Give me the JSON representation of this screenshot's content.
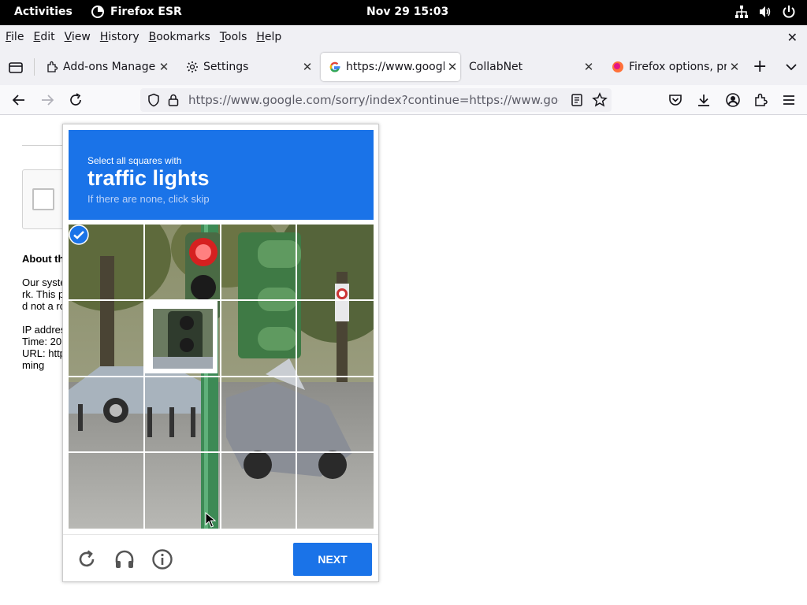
{
  "topbar": {
    "activities": "Activities",
    "app_name": "Firefox ESR",
    "clock": "Nov 29  15:03"
  },
  "menubar": {
    "items": [
      {
        "label": "File",
        "u": "F",
        "rest": "ile"
      },
      {
        "label": "Edit",
        "u": "E",
        "rest": "dit"
      },
      {
        "label": "View",
        "u": "V",
        "rest": "iew"
      },
      {
        "label": "History",
        "u": "H",
        "rest": "istory"
      },
      {
        "label": "Bookmarks",
        "u": "B",
        "rest": "ookmarks"
      },
      {
        "label": "Tools",
        "u": "T",
        "rest": "ools"
      },
      {
        "label": "Help",
        "u": "H",
        "rest": "elp"
      }
    ]
  },
  "tabs": [
    {
      "label": "Add-ons Manager",
      "icon": "puzzle-icon"
    },
    {
      "label": "Settings",
      "icon": "gear-icon"
    },
    {
      "label": "https://www.google.com/sorry",
      "icon": "google-g-icon",
      "active": true
    },
    {
      "label": "CollabNet",
      "icon": ""
    },
    {
      "label": "Firefox options, preferences",
      "icon": "firefox-support-icon"
    }
  ],
  "urlbar": {
    "url": "https://www.google.com/sorry/index?continue=https://www.google.com/search"
  },
  "page": {
    "about_heading": "About th",
    "para_lines": [
      "Our syste",
      "rk. This p",
      "d not a ro"
    ],
    "info_lines": [
      "IP addres",
      "Time: 20",
      "URL: http",
      "ming"
    ]
  },
  "captcha": {
    "instruction": "Select all squares with",
    "target": "traffic lights",
    "hint": "If there are none, click skip",
    "next_label": "NEXT",
    "grid": {
      "rows": 4,
      "cols": 4,
      "selected_tiles": [
        5
      ]
    }
  },
  "colors": {
    "captcha_blue": "#1a73e8",
    "topbar_bg": "#000000"
  }
}
